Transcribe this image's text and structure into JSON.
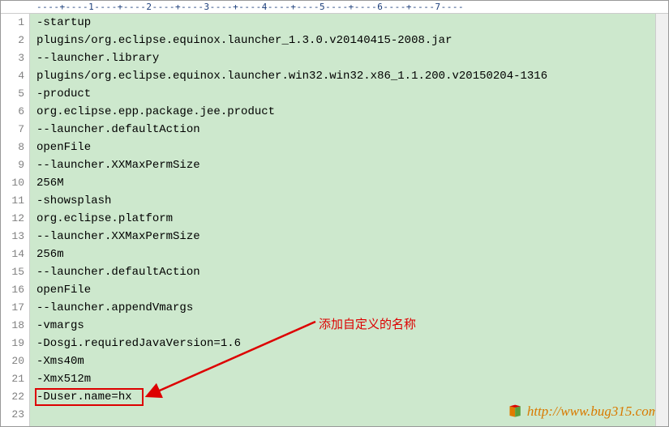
{
  "ruler_text": "----+----1----+----2----+----3----+----4----+----5----+----6----+----7----",
  "lines": [
    "-startup",
    "plugins/org.eclipse.equinox.launcher_1.3.0.v20140415-2008.jar",
    "--launcher.library",
    "plugins/org.eclipse.equinox.launcher.win32.win32.x86_1.1.200.v20150204-1316",
    "-product",
    "org.eclipse.epp.package.jee.product",
    "--launcher.defaultAction",
    "openFile",
    "--launcher.XXMaxPermSize",
    "256M",
    "-showsplash",
    "org.eclipse.platform",
    "--launcher.XXMaxPermSize",
    "256m",
    "--launcher.defaultAction",
    "openFile",
    "--launcher.appendVmargs",
    "-vmargs",
    "-Dosgi.requiredJavaVersion=1.6",
    "-Xms40m",
    "-Xmx512m",
    "-Duser.name=hx",
    ""
  ],
  "annotation": "添加自定义的名称",
  "watermark_url": "http://www.bug315.com"
}
